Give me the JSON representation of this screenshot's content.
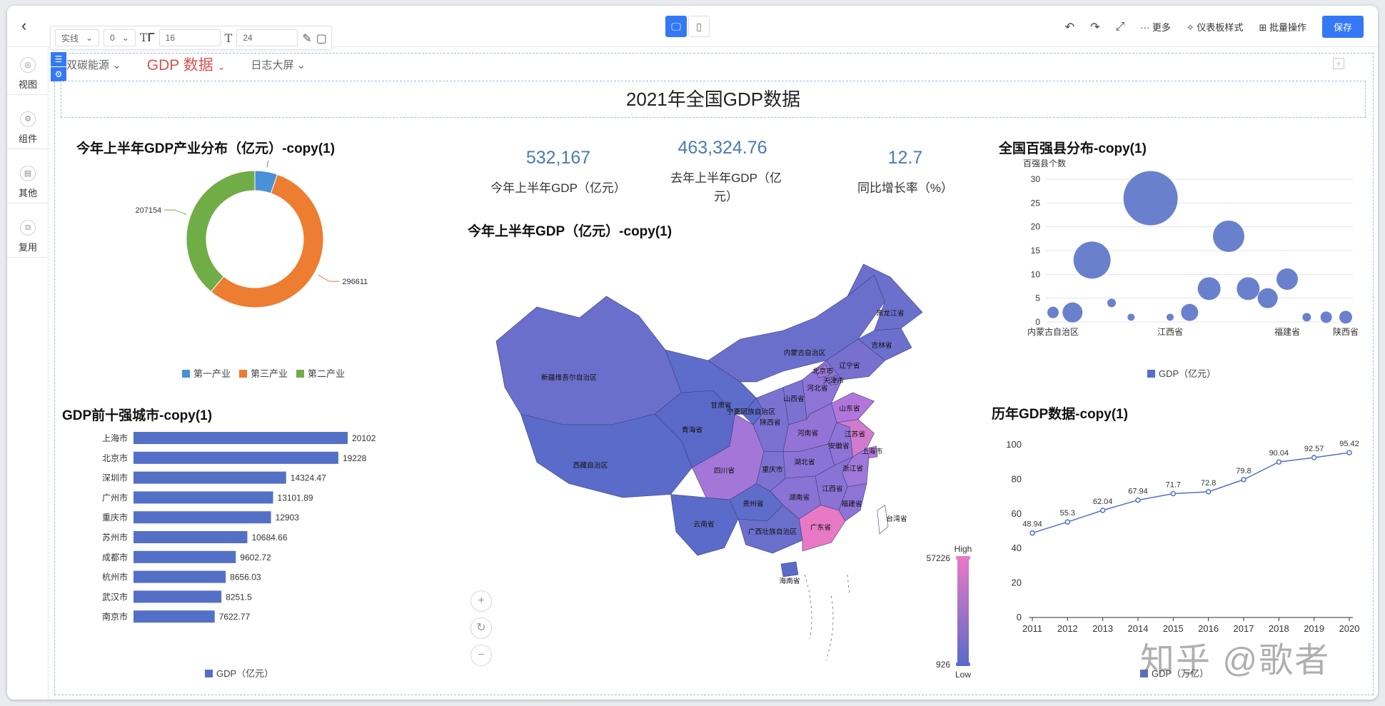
{
  "toolbar": {
    "line_style": "实线",
    "line_width": "0",
    "font_size": "16",
    "text_value": "24",
    "undo_icon": "undo-icon",
    "redo_icon": "redo-icon",
    "fullscreen_icon": "fullscreen-icon",
    "more_label": "··· 更多",
    "theme_label": "仪表板样式",
    "batch_label": "批量操作",
    "save_label": "保存"
  },
  "sidebar": {
    "items": [
      {
        "label": "视图",
        "icon": "view-icon"
      },
      {
        "label": "组件",
        "icon": "component-icon"
      },
      {
        "label": "其他",
        "icon": "other-icon"
      },
      {
        "label": "复用",
        "icon": "reuse-icon"
      }
    ]
  },
  "tabs": [
    {
      "label": "双碳能源"
    },
    {
      "label": "GDP 数据"
    },
    {
      "label": "日志大屏"
    }
  ],
  "dashboard_title": "2021年全国GDP数据",
  "kpis": [
    {
      "value": "532,167",
      "label": "今年上半年GDP（亿元）"
    },
    {
      "value": "463,324.76",
      "label": "去年上半年GDP（亿元）"
    },
    {
      "value": "12.7",
      "label": "同比增长率（%）"
    }
  ],
  "watermark": "知乎 @歌者",
  "colors": {
    "accent": "#3478f6",
    "bar": "#5470c6",
    "donut_primary": "#4a90d9",
    "donut_tertiary": "#ed7d31",
    "donut_secondary": "#70ad47",
    "map_high": "#e879c5",
    "map_low": "#5b6bc9"
  },
  "chart_data": [
    {
      "type": "pie",
      "title": "今年上半年GDP产业分布（亿元）-copy(1)",
      "categories": [
        "第一产业",
        "第三产业",
        "第二产业"
      ],
      "values": [
        28402,
        296611,
        207154
      ],
      "legend": "bottom"
    },
    {
      "type": "bar",
      "orientation": "horizontal",
      "title": "GDP前十强城市-copy(1)",
      "categories": [
        "上海市",
        "北京市",
        "深圳市",
        "广州市",
        "重庆市",
        "苏州市",
        "成都市",
        "杭州市",
        "武汉市",
        "南京市"
      ],
      "values": [
        20102,
        19228,
        14324.47,
        13101.89,
        12903,
        10684.66,
        9602.72,
        8656.03,
        8251.5,
        7622.77
      ],
      "series_name": "GDP（亿元）",
      "legend": "bottom"
    },
    {
      "type": "map",
      "title": "今年上半年GDP（亿元）-copy(1)",
      "visual_map": {
        "high_label": "High",
        "low_label": "Low",
        "max": 57226,
        "min": 926
      },
      "regions": [
        "新疆维吾尔自治区",
        "西藏自治区",
        "青海省",
        "甘肃省",
        "内蒙古自治区",
        "黑龙江省",
        "吉林省",
        "辽宁省",
        "宁夏回族自治区",
        "陕西省",
        "山西省",
        "河北省",
        "北京市",
        "天津市",
        "山东省",
        "河南省",
        "四川省",
        "重庆市",
        "湖北省",
        "安徽省",
        "江苏省",
        "上海市",
        "浙江省",
        "贵州省",
        "湖南省",
        "江西省",
        "福建省",
        "云南省",
        "广西壮族自治区",
        "广东省",
        "海南省",
        "台湾省"
      ]
    },
    {
      "type": "scatter",
      "title": "全国百强县分布-copy(1)",
      "ylabel": "百强县个数",
      "ylim": [
        0,
        30
      ],
      "y_ticks": [
        0,
        5,
        10,
        15,
        20,
        25,
        30
      ],
      "x_tick_labels": [
        "内蒙古自治区",
        "江西省",
        "福建省",
        "陕西省"
      ],
      "series_name": "GDP（亿元）",
      "points": [
        {
          "x": 0,
          "y": 2
        },
        {
          "x": 1,
          "y": 2
        },
        {
          "x": 2,
          "y": 13
        },
        {
          "x": 3,
          "y": 4
        },
        {
          "x": 4,
          "y": 1
        },
        {
          "x": 5,
          "y": 26
        },
        {
          "x": 6,
          "y": 1
        },
        {
          "x": 7,
          "y": 2
        },
        {
          "x": 8,
          "y": 7
        },
        {
          "x": 9,
          "y": 18
        },
        {
          "x": 10,
          "y": 7
        },
        {
          "x": 11,
          "y": 5
        },
        {
          "x": 12,
          "y": 9
        },
        {
          "x": 13,
          "y": 1
        },
        {
          "x": 14,
          "y": 1
        },
        {
          "x": 15,
          "y": 1
        }
      ],
      "legend": "bottom"
    },
    {
      "type": "line",
      "title": "历年GDP数据-copy(1)",
      "categories": [
        "2011",
        "2012",
        "2013",
        "2014",
        "2015",
        "2016",
        "2017",
        "2018",
        "2019",
        "2020"
      ],
      "values": [
        48.94,
        55.3,
        62.04,
        67.94,
        71.7,
        72.8,
        79.8,
        90.04,
        92.57,
        95.42
      ],
      "ylim": [
        0,
        100
      ],
      "y_ticks": [
        0,
        20,
        40,
        60,
        80,
        100
      ],
      "series_name": "GDP（万亿）",
      "legend": "bottom"
    }
  ]
}
